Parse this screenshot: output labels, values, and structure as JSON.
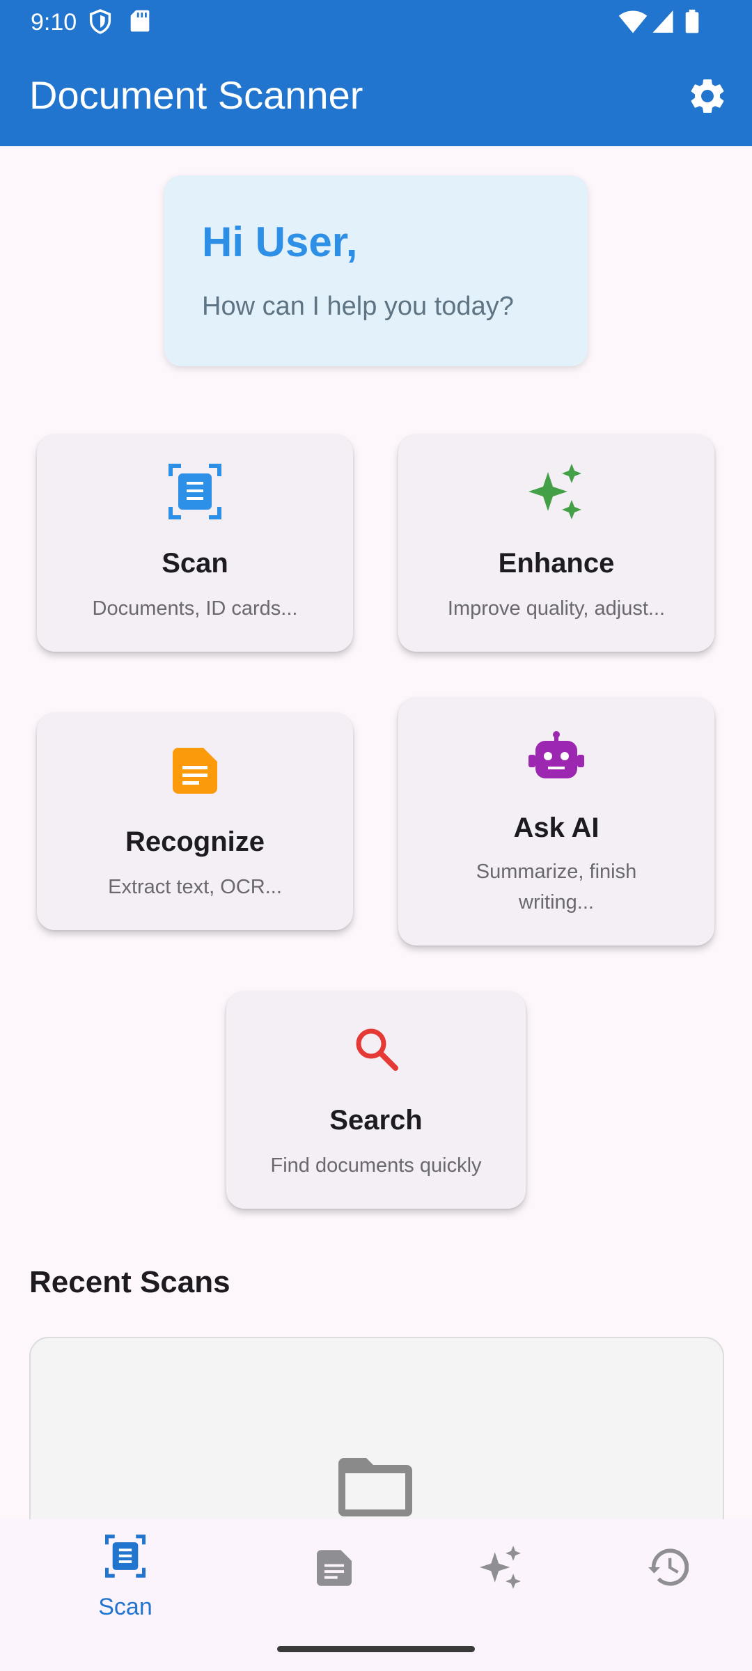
{
  "status": {
    "time": "9:10",
    "icons": [
      "shield-icon",
      "sd-card-icon",
      "wifi-icon",
      "signal-icon",
      "battery-icon"
    ]
  },
  "app": {
    "title": "Document Scanner",
    "settings_icon": "gear-icon"
  },
  "greeting": {
    "title": "Hi User,",
    "subtitle": "How can I help you today?"
  },
  "actions": [
    {
      "key": "scan",
      "title": "Scan",
      "subtitle": "Documents, ID cards...",
      "icon": "document-scanner-icon",
      "color": "#2C8FE8"
    },
    {
      "key": "enhance",
      "title": "Enhance",
      "subtitle": "Improve quality, adjust...",
      "icon": "sparkle-icon",
      "color": "#43A047"
    },
    {
      "key": "recognize",
      "title": "Recognize",
      "subtitle": "Extract text, OCR...",
      "icon": "text-document-icon",
      "color": "#FB9A0B"
    },
    {
      "key": "ask_ai",
      "title": "Ask AI",
      "subtitle": "Summarize, finish writing...",
      "icon": "robot-icon",
      "color": "#9C27B0"
    },
    {
      "key": "search",
      "title": "Search",
      "subtitle": "Find documents quickly",
      "icon": "search-icon",
      "color": "#E53935"
    }
  ],
  "recent": {
    "title": "Recent Scans",
    "empty_icon": "folder-icon"
  },
  "bottom_nav": {
    "active_color": "#2275CE",
    "inactive_color": "#8E8E93",
    "items": [
      {
        "label": "Scan",
        "icon": "document-scanner-icon",
        "active": true
      },
      {
        "label": "",
        "icon": "text-document-icon",
        "active": false
      },
      {
        "label": "",
        "icon": "sparkle-icon",
        "active": false
      },
      {
        "label": "",
        "icon": "history-icon",
        "active": false
      }
    ]
  }
}
